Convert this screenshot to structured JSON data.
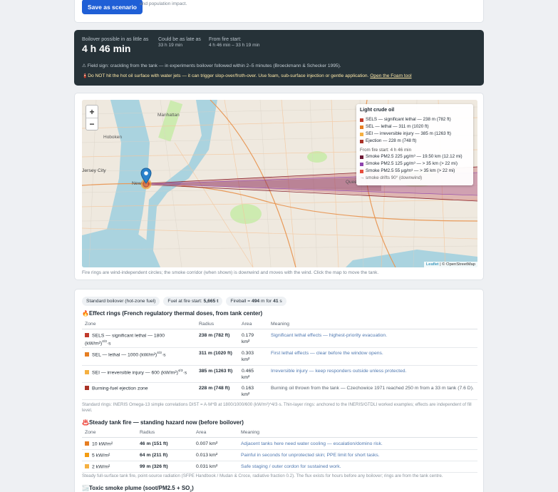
{
  "save": {
    "button_label": "Save as scenario",
    "note": "Persists the dose rings + ejection zone as a CERES scenario — report, KMZ/Shapefile/CAP export and population impact."
  },
  "boilover": {
    "stat1_label": "Boilover possible in as little as",
    "stat1_value": "4 h 46 min",
    "stat2_label": "Could be as late as",
    "stat2_value": "33 h 19 min",
    "stat3_label": "From fire start:",
    "stat3_value": "4 h 46 min – 33 h 19 min",
    "field_sign": "⚠ Field sign: crackling from the tank — in experiments boilover followed within 2–5 minutes (Broeckmann & Schecker 1995).",
    "warning": "🧯Do NOT hit the hot oil surface with water jets — it can trigger slop-over/froth-over. Use foam, sub-surface injection or gentle application.",
    "warning_link": "Open the Foam tool"
  },
  "map": {
    "zoom_in": "+",
    "zoom_out": "−",
    "place_labels": [
      "Manhattan",
      "Hoboken",
      "Jersey City",
      "New",
      "Quee"
    ],
    "legend": {
      "title": "Light crude oil",
      "rings": [
        {
          "label": "SELS — significant lethal — 238 m (782 ft)",
          "color": "#c0392b"
        },
        {
          "label": "SEL — lethal — 311 m (1020 ft)",
          "color": "#e67e22"
        },
        {
          "label": "SEI — irreversible injury — 385 m (1263 ft)",
          "color": "#f5b041"
        },
        {
          "label": "Ejection — 228 m (748 ft)",
          "color": "#a93226"
        }
      ],
      "smoke_title": "From fire start: 4 h 46 min",
      "smoke": [
        {
          "label": "Smoke PM2.5 225 µg/m³ — 19.50 km (12.12 mi)",
          "color": "#6d1a36"
        },
        {
          "label": "Smoke PM2.5 125 µg/m³ — > 35 km (> 22 mi)",
          "color": "#8e44ad"
        },
        {
          "label": "Smoke PM2.5 55 µg/m³ — > 35 km (> 22 mi)",
          "color": "#e74c3c"
        }
      ],
      "drift": "→ smoke drifts 90° (downwind)"
    },
    "attribution_leaflet": "Leaflet",
    "attribution_rest": " | © OpenStreetMap",
    "caption": "Fire rings are wind-independent circles; the smoke corridor (when shown) is downwind and moves with the wind. Click the map to move the tank."
  },
  "effects": {
    "chips": [
      {
        "text": "Standard boilover (hot-zone fuel)"
      },
      {
        "label": "Fuel at fire start: ",
        "value": "5,665 t"
      },
      {
        "label": "Fireball = ",
        "value": "494",
        "mid": " m for ",
        "value2": "41",
        "end": " s"
      }
    ],
    "section1_title": "🔥Effect rings (French regulatory thermal doses, from tank center)",
    "cols1": [
      "Zone",
      "Radius",
      "Area",
      "Meaning"
    ],
    "rows1": [
      {
        "zone": "SELS — significant lethal — 1800 (kW/m²)",
        "zone_sup": "4/3",
        "zone_end": "·s",
        "color": "#c0392b",
        "radius": "238 m (782 ft)",
        "area": "0.179 km²",
        "meaning": "Significant lethal effects — highest-priority evacuation."
      },
      {
        "zone": "SEL — lethal — 1000 (kW/m²)",
        "zone_sup": "4/3",
        "zone_end": "·s",
        "color": "#e67e22",
        "radius": "311 m (1020 ft)",
        "area": "0.303 km²",
        "meaning": "First lethal effects — clear before the window opens."
      },
      {
        "zone": "SEI — irreversible injury — 600 (kW/m²)",
        "zone_sup": "4/3",
        "zone_end": "·s",
        "color": "#f5b041",
        "radius": "385 m (1263 ft)",
        "area": "0.465 km²",
        "meaning": "Irreversible injury — keep responders outside unless protected."
      },
      {
        "zone": "Burning-fuel ejection zone",
        "zone_sup": "",
        "zone_end": "",
        "color": "#a93226",
        "radius": "228 m (748 ft)",
        "area": "0.163 km²",
        "meaning": "Burning oil thrown from the tank — Czechowice 1971 reached 250 m from a 33 m tank (7.6 D)."
      }
    ],
    "note1": "Standard rings: INERIS Omega-13 simple correlations DIST = A·M^B at 1800/1000/600 (kW/m²)^4/3·s. Thin-layer rings: anchored to the INERIS/GTDLI worked examples; effects are independent of fill level.",
    "section2_title": "♨️Steady tank fire — standing hazard now (before boilover)",
    "cols2": [
      "Zone",
      "Radius",
      "Area",
      "Meaning"
    ],
    "rows2": [
      {
        "zone": "10 kW/m²",
        "color": "#e67e22",
        "radius": "46 m (151 ft)",
        "area": "0.007 km²",
        "meaning": "Adjacent tanks here need water cooling — escalation/domino risk."
      },
      {
        "zone": "5 kW/m²",
        "color": "#f39c12",
        "radius": "64 m (211 ft)",
        "area": "0.013 km²",
        "meaning": "Painful in seconds for unprotected skin; PPE limit for short tasks."
      },
      {
        "zone": "2 kW/m²",
        "color": "#f5b041",
        "radius": "99 m (326 ft)",
        "area": "0.031 km²",
        "meaning": "Safe staging / outer cordon for sustained work."
      }
    ],
    "note2": "Steady full-surface tank fire, point-source radiation (SFPE Handbook / Mudan & Croce, radiative fraction 0.2). The flux exists for hours before any boilover; rings are from the tank centre.",
    "section3_title": "🌫️Toxic smoke plume (soot/PM2.5 + SO",
    "section3_sub": "2",
    "section3_end": ")"
  }
}
